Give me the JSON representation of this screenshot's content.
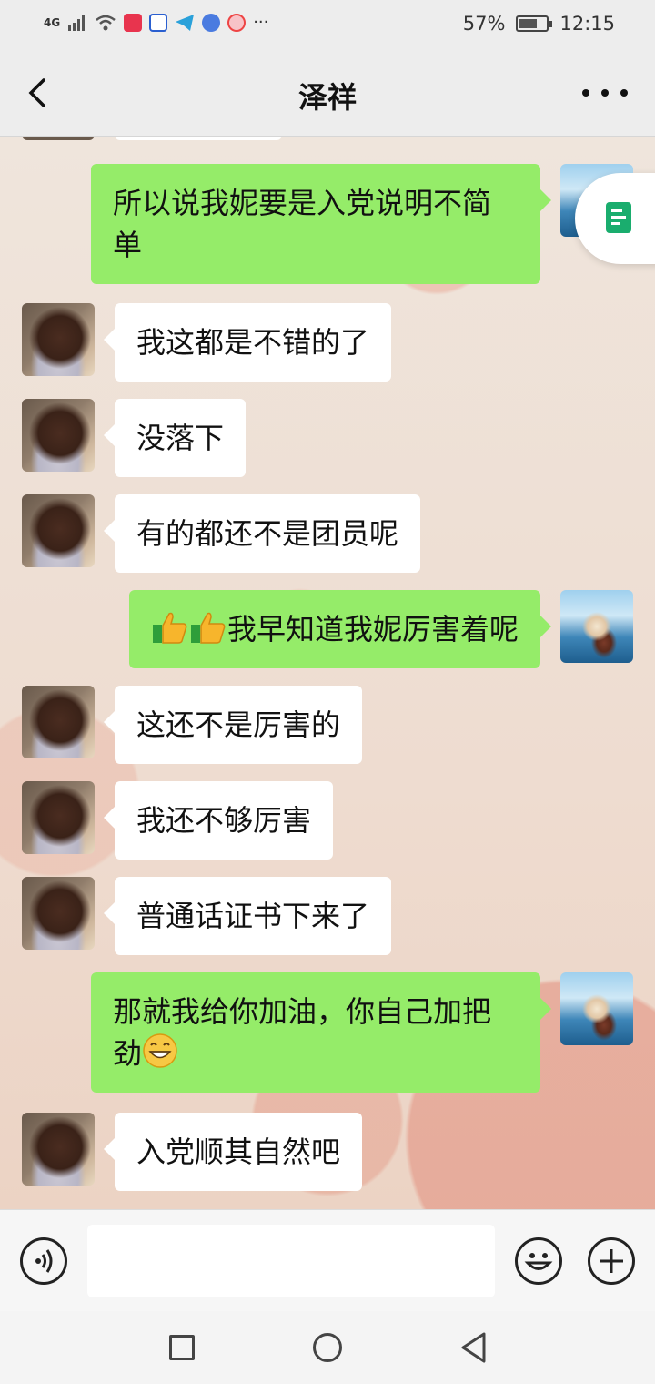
{
  "status_bar": {
    "network": "4G",
    "battery_percent": "57%",
    "battery_level": 0.57,
    "time": "12:15",
    "more_notifications": "···"
  },
  "header": {
    "title": "泽祥",
    "back_icon": "chevron-left-icon",
    "more_icon": "more-dots-icon"
  },
  "messages": [
    {
      "side": "right",
      "sender": "me",
      "text": "所以说我妮要是入党说明不简单"
    },
    {
      "side": "left",
      "sender": "friend",
      "text": "我这都是不错的了"
    },
    {
      "side": "left",
      "sender": "friend",
      "text": "没落下"
    },
    {
      "side": "left",
      "sender": "friend",
      "text": "有的都还不是团员呢"
    },
    {
      "side": "right",
      "sender": "me",
      "text": "我早知道我妮厉害着呢",
      "prefix_emojis": [
        "thumbs-up",
        "thumbs-up"
      ]
    },
    {
      "side": "left",
      "sender": "friend",
      "text": "这还不是厉害的"
    },
    {
      "side": "left",
      "sender": "friend",
      "text": "我还不够厉害"
    },
    {
      "side": "left",
      "sender": "friend",
      "text": "普通话证书下来了"
    },
    {
      "side": "right",
      "sender": "me",
      "text": "那就我给你加油，你自己加把劲",
      "suffix_emoji": "grin"
    },
    {
      "side": "left",
      "sender": "friend",
      "text": "入党顺其自然吧"
    }
  ],
  "input_bar": {
    "voice_icon": "voice-icon",
    "text_value": "",
    "emoji_icon": "emoji-icon",
    "plus_icon": "plus-icon"
  },
  "nav_bar": {
    "recent_icon": "square-icon",
    "home_icon": "circle-icon",
    "back_icon": "triangle-back-icon"
  },
  "colors": {
    "my_bubble": "#95ec69",
    "friend_bubble": "#ffffff",
    "header_bg": "#ededed"
  }
}
